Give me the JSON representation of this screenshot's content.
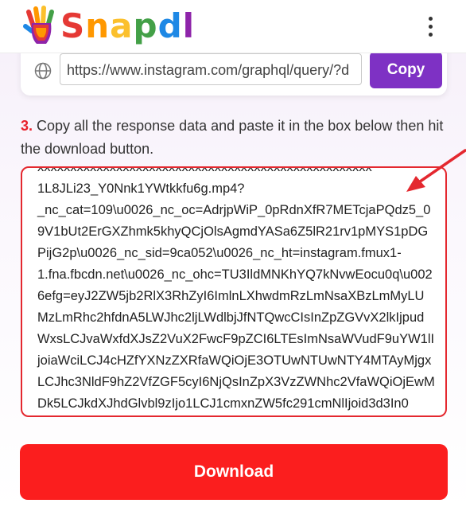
{
  "header": {
    "logo_text": "Snapdl",
    "logo_letters": [
      {
        "char": "S",
        "color": "#e53935"
      },
      {
        "char": "n",
        "color": "#ff9800"
      },
      {
        "char": "a",
        "color": "#fbc02d"
      },
      {
        "char": "p",
        "color": "#43a047"
      },
      {
        "char": "d",
        "color": "#1e88e5"
      },
      {
        "char": "l",
        "color": "#8e24aa"
      }
    ],
    "menu_icon": "more-vertical-icon"
  },
  "url_row": {
    "globe_icon": "globe-icon",
    "url_value": "https://www.instagram.com/graphql/query/?d",
    "copy_label": "Copy"
  },
  "instruction": {
    "step_number": "3.",
    "text": " Copy all the response data and paste it in the box below then hit the download button."
  },
  "response_box": {
    "value": "xxxxxxxxxxxxxxxxxxxxxxxxxxxxxxxxxxxxxxxxxxxxxxxxxxx\n1L8JLi23_Y0Nnk1YWtkkfu6g.mp4?\n_nc_cat=109\\u0026_nc_oc=AdrjpWiP_0pRdnXfR7METcjaPQdz5_09V1bUt2ErGXZhmk5khyQCjOlsAgmdYASa6Z5lR21rv1pMYS1pDGPijG2p\\u0026_nc_sid=9ca052\\u0026_nc_ht=instagram.fmux1-\n1.fna.fbcdn.net\\u0026_nc_ohc=TU3IldMNKhYQ7kNvwEocu0q\\u0026efg=eyJ2ZW5jb2RlX3RhZyI6ImlnLXhwdmRzLmNsaXBzLmMyLUMzLmRhc2hfdnA5LWJhc2ljLWdlbjJfNTQwcCIsInZpZGVvX2lkIjpudWxsLCJvaWxfdXJsZ2VuX2FwcF9pZCI6LTEsImNsaWVudF9uYW1lIjoiaWciLCJ4cHZfYXNzZXRfaWQiOjE3OTUwNTUwNTY4MTAyMjgxLCJhc3NldF9hZ2VfZGF5cyI6NjQsInZpX3VzZWNhc2VfaWQiOjEwMDk5LCJkdXJhdGlvbl9zIjo1LCJ1cmxnZW5fc291cmNlIjoid3d3In0"
  },
  "download_label": "Download",
  "colors": {
    "accent_purple": "#7e31c4",
    "accent_red": "#fb1e1e",
    "step_red": "#e8202a"
  }
}
